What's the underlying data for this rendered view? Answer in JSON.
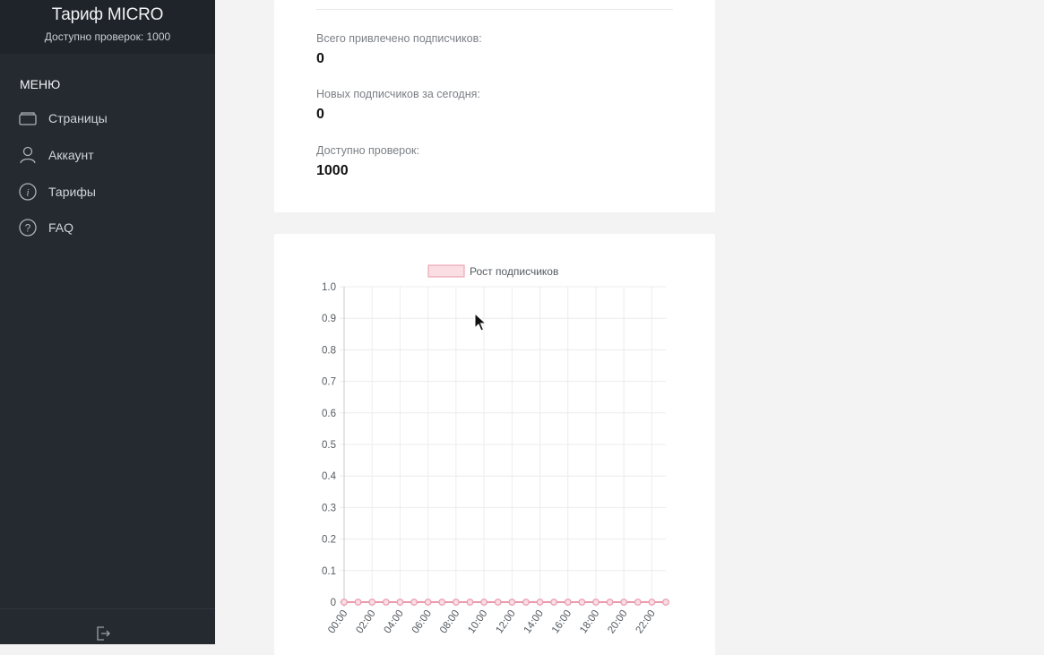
{
  "sidebar": {
    "plan_title": "Тариф MICRO",
    "plan_subtitle": "Доступно проверок: 1000",
    "menu_title": "МЕНЮ",
    "items": [
      {
        "label": "Страницы",
        "icon": "wallet-icon"
      },
      {
        "label": "Аккаунт",
        "icon": "user-icon"
      },
      {
        "label": "Тарифы",
        "icon": "info-icon"
      },
      {
        "label": "FAQ",
        "icon": "help-icon"
      }
    ],
    "footer_icon": "logout-icon"
  },
  "stats": {
    "items": [
      {
        "label": "Всего привлечено подписчиков:",
        "value": "0"
      },
      {
        "label": "Новых подписчиков за сегодня:",
        "value": "0"
      },
      {
        "label": "Доступно проверок:",
        "value": "1000"
      }
    ]
  },
  "colors": {
    "sidebar_bg": "#252a31",
    "series_line": "#e89aab",
    "series_fill": "#fbdde4"
  },
  "chart_data": {
    "type": "line",
    "legend_position": "top",
    "grid": true,
    "x": [
      "00:00",
      "01:00",
      "02:00",
      "03:00",
      "04:00",
      "05:00",
      "06:00",
      "07:00",
      "08:00",
      "09:00",
      "10:00",
      "11:00",
      "12:00",
      "13:00",
      "14:00",
      "15:00",
      "16:00",
      "17:00",
      "18:00",
      "19:00",
      "20:00",
      "21:00",
      "22:00",
      "23:00"
    ],
    "x_tick_labels": [
      "00:00",
      "02:00",
      "04:00",
      "06:00",
      "08:00",
      "10:00",
      "12:00",
      "14:00",
      "16:00",
      "18:00",
      "20:00",
      "22:00"
    ],
    "y_ticks": [
      0,
      0.1,
      0.2,
      0.3,
      0.4,
      0.5,
      0.6,
      0.7,
      0.8,
      0.9,
      1.0
    ],
    "y_tick_labels": [
      "0",
      "0.1",
      "0.2",
      "0.3",
      "0.4",
      "0.5",
      "0.6",
      "0.7",
      "0.8",
      "0.9",
      "1.0"
    ],
    "ylim": [
      0,
      1.0
    ],
    "series": [
      {
        "name": "Рост подписчиков",
        "values": [
          0,
          0,
          0,
          0,
          0,
          0,
          0,
          0,
          0,
          0,
          0,
          0,
          0,
          0,
          0,
          0,
          0,
          0,
          0,
          0,
          0,
          0,
          0,
          0
        ]
      }
    ]
  }
}
